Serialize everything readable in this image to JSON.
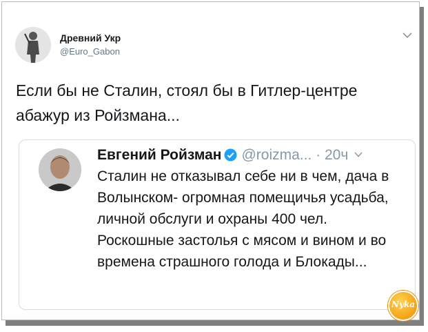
{
  "tweet": {
    "author_name": "Древний Укр",
    "author_handle": "@Euro_Gabon",
    "text": "Если бы не Сталин, стоял бы в Гитлер-центре абажур из Ройзмана..."
  },
  "quoted_tweet": {
    "author_name": "Евгений Ройзман",
    "author_handle": "@roizma...",
    "separator": "·",
    "time": "20ч",
    "text": "Сталин не отказывал себе ни в чем, дача в Волынском- огромная помещичья усадьба, личной обслуги и охраны 400 чел. Роскошные застолья с мясом и вином и во времена страшного голода и Блокады..."
  },
  "watermark": {
    "text": "Nyka"
  },
  "icons": {
    "tweet_menu": "chevron-down-icon",
    "verified": "verified-badge-icon",
    "quoted_menu": "chevron-down-icon"
  },
  "colors": {
    "verified": "#1da1f2",
    "secondary_text": "#8899a6",
    "border": "#d5dbe1",
    "badge": "#f5a623"
  }
}
